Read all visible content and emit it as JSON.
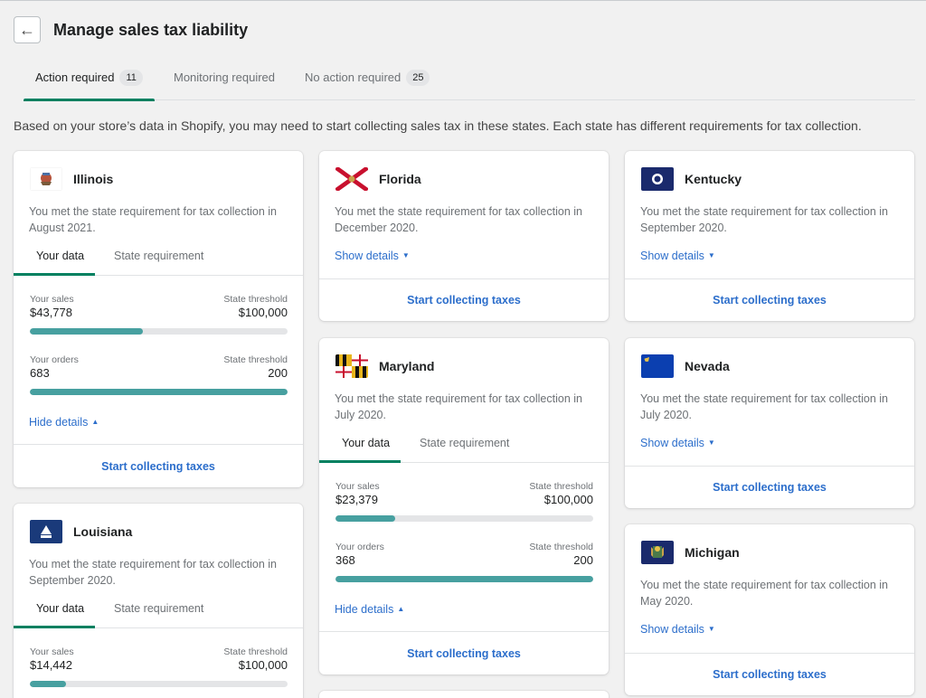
{
  "page": {
    "title": "Manage sales tax liability",
    "intro": "Based on your store’s data in Shopify, you may need to start collecting sales tax in these states. Each state has different requirements for tax collection."
  },
  "tabs": [
    {
      "label": "Action required",
      "count": "11"
    },
    {
      "label": "Monitoring required",
      "count": ""
    },
    {
      "label": "No action required",
      "count": "25"
    }
  ],
  "labels": {
    "your_data": "Your data",
    "state_requirement": "State requirement",
    "your_sales": "Your sales",
    "your_orders": "Your orders",
    "state_threshold": "State threshold",
    "show_details": "Show details",
    "hide_details": "Hide details",
    "cta": "Start collecting taxes"
  },
  "cards": {
    "illinois": {
      "name": "Illinois",
      "desc": "You met the state requirement for tax collection in August 2021.",
      "sales": "$43,778",
      "sales_threshold": "$100,000",
      "sales_fill": 0.44,
      "orders": "683",
      "orders_threshold": "200",
      "orders_fill": 1.0
    },
    "louisiana": {
      "name": "Louisiana",
      "desc": "You met the state requirement for tax collection in September 2020.",
      "sales": "$14,442",
      "sales_threshold": "$100,000",
      "sales_fill": 0.14
    },
    "florida": {
      "name": "Florida",
      "desc": "You met the state requirement for tax collection in December 2020."
    },
    "maryland": {
      "name": "Maryland",
      "desc": "You met the state requirement for tax collection in July 2020.",
      "sales": "$23,379",
      "sales_threshold": "$100,000",
      "sales_fill": 0.23,
      "orders": "368",
      "orders_threshold": "200",
      "orders_fill": 1.0
    },
    "kentucky": {
      "name": "Kentucky",
      "desc": "You met the state requirement for tax collection in September 2020."
    },
    "nevada": {
      "name": "Nevada",
      "desc": "You met the state requirement for tax collection in July 2020."
    },
    "michigan": {
      "name": "Michigan",
      "desc": "You met the state requirement for tax collection in May 2020."
    }
  },
  "colors": {
    "accent": "#008060",
    "link": "#2c6ecb",
    "bar": "#47a0a0"
  }
}
